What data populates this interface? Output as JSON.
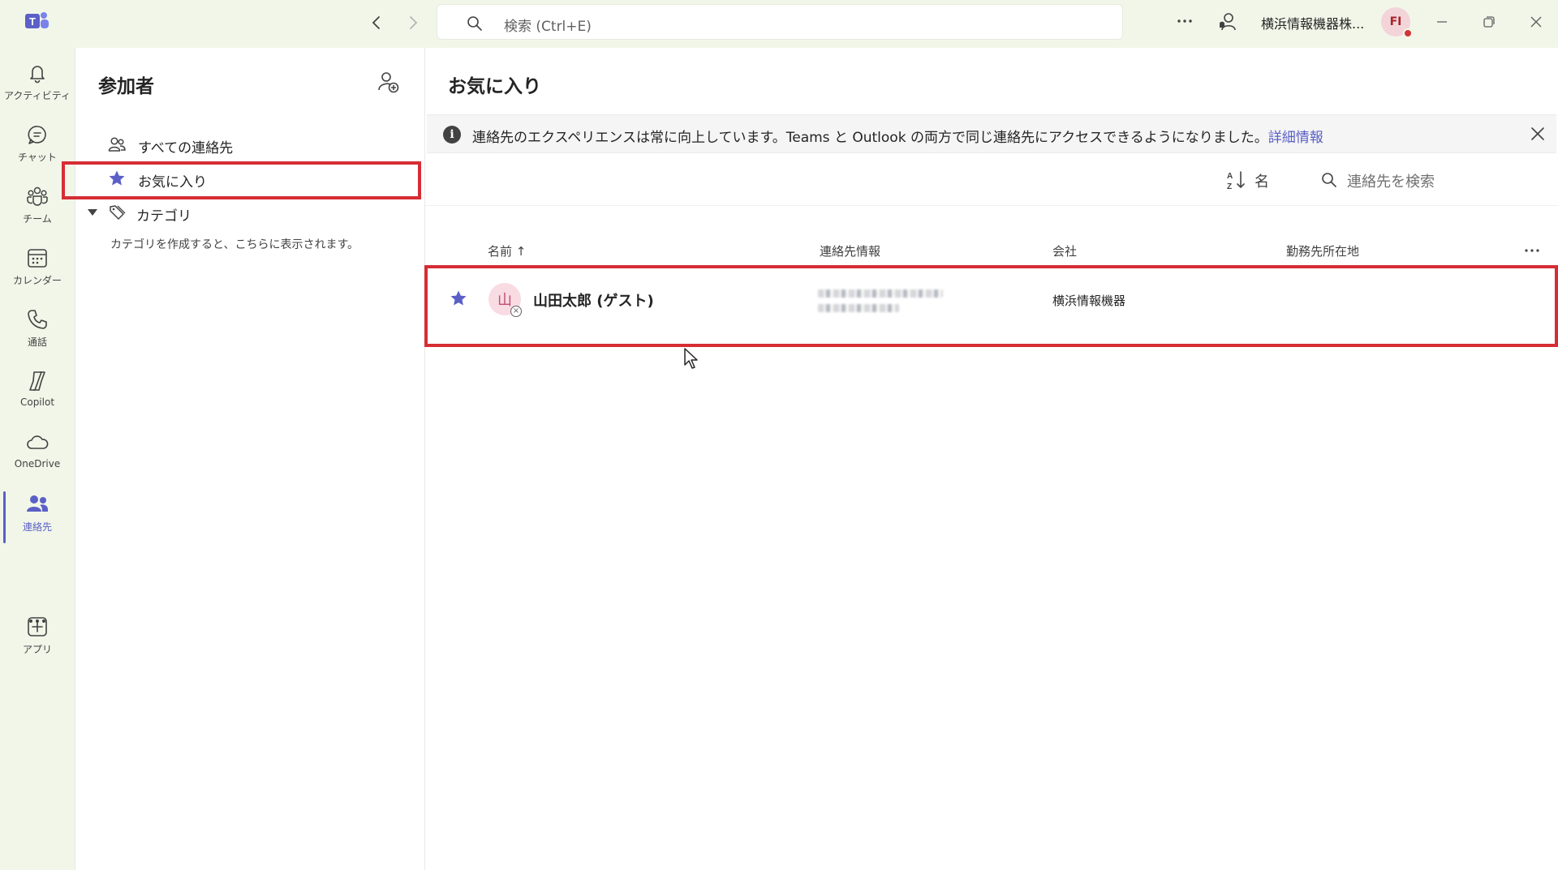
{
  "titlebar": {
    "search_placeholder": "検索 (Ctrl+E)",
    "org_name": "横浜情報機器株...",
    "avatar_initials": "FI"
  },
  "rail": {
    "items": [
      {
        "label": "アクティビティ",
        "icon": "bell-icon"
      },
      {
        "label": "チャット",
        "icon": "chat-icon"
      },
      {
        "label": "チーム",
        "icon": "teams-icon"
      },
      {
        "label": "カレンダー",
        "icon": "calendar-icon"
      },
      {
        "label": "通話",
        "icon": "phone-icon"
      },
      {
        "label": "Copilot",
        "icon": "copilot-icon"
      },
      {
        "label": "OneDrive",
        "icon": "cloud-icon"
      },
      {
        "label": "連絡先",
        "icon": "people-icon",
        "active": true
      },
      {
        "label": "アプリ",
        "icon": "add-app-icon"
      }
    ]
  },
  "pane": {
    "title": "参加者",
    "all_contacts": "すべての連絡先",
    "favorites": "お気に入り",
    "category": "カテゴリ",
    "category_hint": "カテゴリを作成すると、こちらに表示されます。"
  },
  "main": {
    "title": "お気に入り",
    "banner_text": "連絡先のエクスペリエンスは常に向上しています。Teams と Outlook の両方で同じ連絡先にアクセスできるようになりました。",
    "banner_link": "詳細情報",
    "sort_label": "名",
    "search_placeholder": "連絡先を検索",
    "columns": {
      "name": "名前 ↑",
      "contact_info": "連絡先情報",
      "company": "会社",
      "office": "勤務先所在地"
    },
    "rows": [
      {
        "avatar": "山",
        "name": "山田太郎 (ゲスト)",
        "company": "横浜情報機器",
        "favorite": true
      }
    ]
  },
  "colors": {
    "accent": "#5b5fc7",
    "highlight": "#d62d35",
    "rail_bg": "#f1f6e9"
  }
}
